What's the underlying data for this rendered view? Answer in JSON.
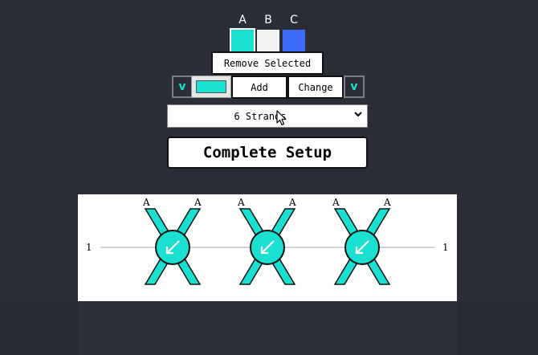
{
  "palette": {
    "swatches": [
      {
        "label": "A",
        "color": "#19e0d0"
      },
      {
        "label": "B",
        "color": "#f2f2f2"
      },
      {
        "label": "C",
        "color": "#3d6bf5"
      }
    ],
    "selected": "A"
  },
  "toolbar": {
    "remove_label": "Remove Selected",
    "prev_label": "v",
    "next_label": "v",
    "picker_color": "#19e0d0",
    "add_label": "Add",
    "change_label": "Change"
  },
  "strands_select": {
    "value": "6 Strands"
  },
  "complete_label": "Complete Setup",
  "diagram": {
    "left_label": "1",
    "right_label": "1",
    "crossings": [
      {
        "top_left": "A",
        "top_right": "A"
      },
      {
        "top_left": "A",
        "top_right": "A"
      },
      {
        "top_left": "A",
        "top_right": "A"
      }
    ],
    "strand_color": "#19e0d0",
    "knot_icon": "arrow-down-left-icon"
  }
}
